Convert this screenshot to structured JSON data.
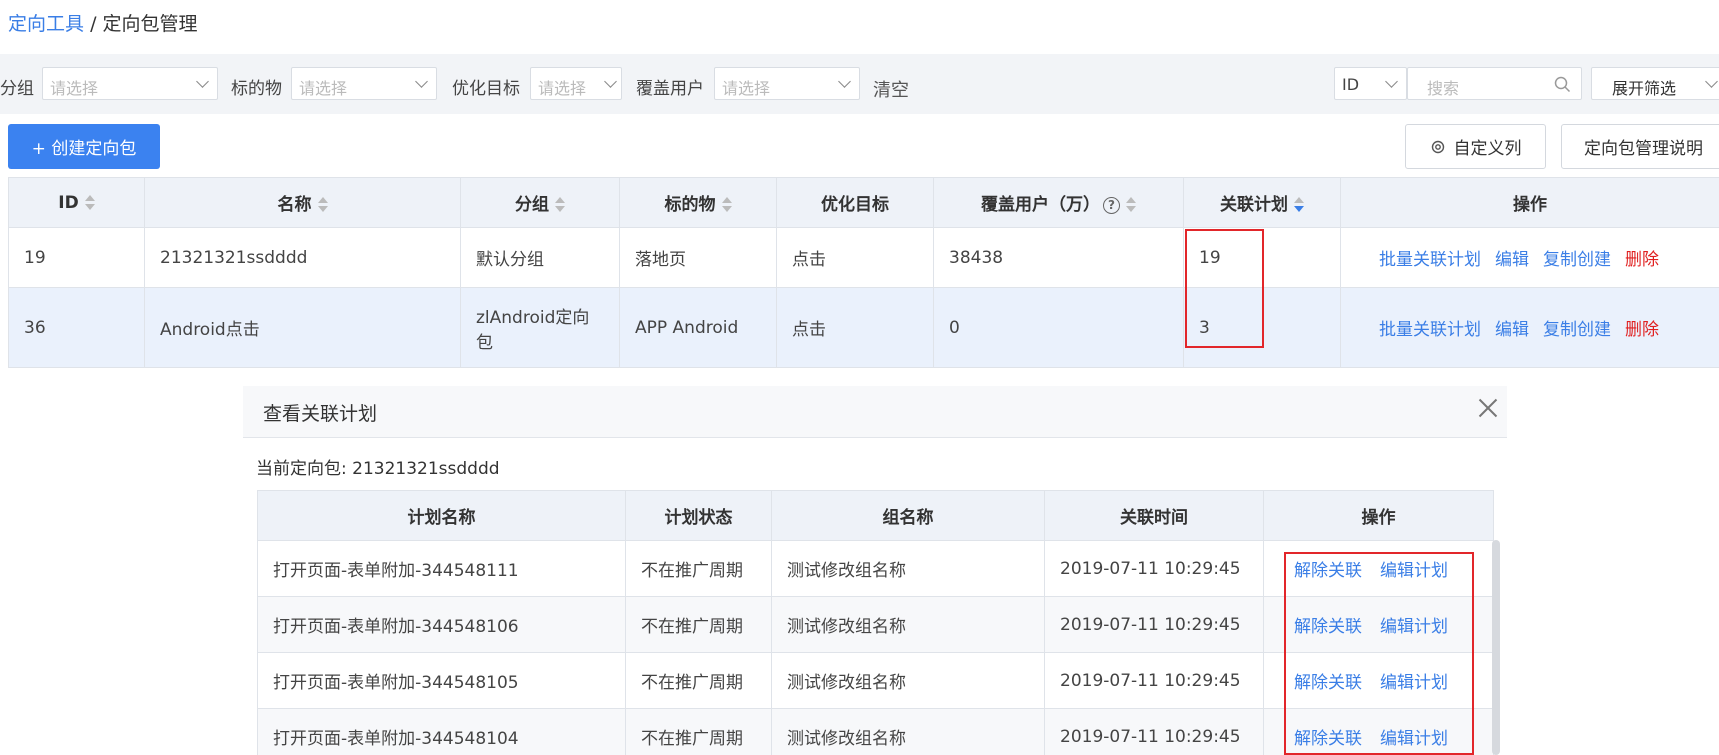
{
  "breadcrumb": {
    "root": "定向工具",
    "sep": "/",
    "current": "定向包管理"
  },
  "filters": {
    "group_label": "分组",
    "group_placeholder": "请选择",
    "target_label": "标的物",
    "target_placeholder": "请选择",
    "goal_label": "优化目标",
    "goal_placeholder": "请选择",
    "cover_label": "覆盖用户",
    "cover_placeholder": "请选择",
    "clear": "清空",
    "id_select": "ID",
    "search_placeholder": "搜索",
    "expand": "展开筛选"
  },
  "toolbar": {
    "create": "+ 创建定向包",
    "custom_columns": "自定义列",
    "help": "定向包管理说明"
  },
  "main_table": {
    "headers": [
      "ID",
      "名称",
      "分组",
      "标的物",
      "优化目标",
      "覆盖用户（万）",
      "关联计划",
      "操作"
    ],
    "rows": [
      {
        "id": "19",
        "name": "21321321ssdddd",
        "group": "默认分组",
        "target": "落地页",
        "goal": "点击",
        "cover": "38438",
        "plans": "19"
      },
      {
        "id": "36",
        "name": "Android点击",
        "group": "zlAndroid定向包",
        "target": "APP Android",
        "goal": "点击",
        "cover": "0",
        "plans": "3"
      }
    ],
    "ops": {
      "batch": "批量关联计划",
      "edit": "编辑",
      "copy": "复制创建",
      "delete": "删除"
    }
  },
  "modal": {
    "title": "查看关联计划",
    "current_label": "当前定向包: 21321321ssdddd",
    "headers": [
      "计划名称",
      "计划状态",
      "组名称",
      "关联时间",
      "操作"
    ],
    "rows": [
      {
        "name": "打开页面-表单附加-344548111",
        "status": "不在推广周期",
        "group": "测试修改组名称",
        "time": "2019-07-11 10:29:45"
      },
      {
        "name": "打开页面-表单附加-344548106",
        "status": "不在推广周期",
        "group": "测试修改组名称",
        "time": "2019-07-11 10:29:45"
      },
      {
        "name": "打开页面-表单附加-344548105",
        "status": "不在推广周期",
        "group": "测试修改组名称",
        "time": "2019-07-11 10:29:45"
      },
      {
        "name": "打开页面-表单附加-344548104",
        "status": "不在推广周期",
        "group": "测试修改组名称",
        "time": "2019-07-11 10:29:45"
      }
    ],
    "ops": {
      "unlink": "解除关联",
      "edit": "编辑计划"
    }
  },
  "colors": {
    "primary": "#3b82f0",
    "link": "#3a7ee6",
    "danger": "#e02020",
    "highlight": "#e2262a"
  }
}
